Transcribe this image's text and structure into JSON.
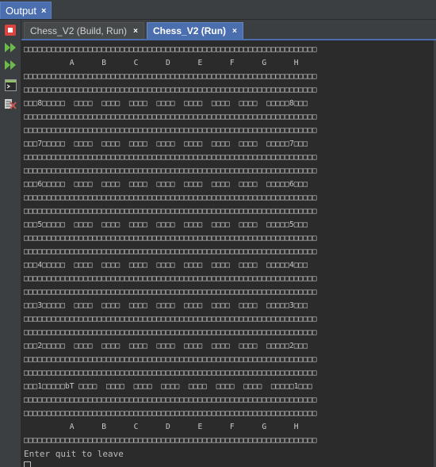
{
  "window": {
    "output_tab_label": "Output",
    "output_tab_close": "×"
  },
  "run_tabs": [
    {
      "label": "Chess_V2 (Build, Run)",
      "close": "×",
      "active": false
    },
    {
      "label": "Chess_V2 (Run)",
      "close": "×",
      "active": true
    }
  ],
  "sidebar": {
    "buttons": [
      {
        "icon": "stop-icon",
        "color": "#d9453f"
      },
      {
        "icon": "rerun-icon",
        "color": "#6dbb4a"
      },
      {
        "icon": "rerun-with-different-params-icon",
        "color": "#6dbb4a"
      },
      {
        "icon": "terminal-settings-icon",
        "color": "#8fbf6a"
      },
      {
        "icon": "clear-output-icon",
        "color": "#c75450"
      }
    ]
  },
  "console": {
    "lines": [
      "□□□□□□□□□□□□□□□□□□□□□□□□□□□□□□□□□□□□□□□□□□□□□□□□□□□□□□□□□□□□□□□□",
      "          A      B      C      D      E      F      G      H",
      "□□□□□□□□□□□□□□□□□□□□□□□□□□□□□□□□□□□□□□□□□□□□□□□□□□□□□□□□□□□□□□□□",
      "□□□□□□□□□□□□□□□□□□□□□□□□□□□□□□□□□□□□□□□□□□□□□□□□□□□□□□□□□□□□□□□□",
      "□□□8□□□□□  □□□□  □□□□  □□□□  □□□□  □□□□  □□□□  □□□□  □□□□□8□□□",
      "□□□□□□□□□□□□□□□□□□□□□□□□□□□□□□□□□□□□□□□□□□□□□□□□□□□□□□□□□□□□□□□□",
      "□□□□□□□□□□□□□□□□□□□□□□□□□□□□□□□□□□□□□□□□□□□□□□□□□□□□□□□□□□□□□□□□",
      "□□□7□□□□□  □□□□  □□□□  □□□□  □□□□  □□□□  □□□□  □□□□  □□□□□7□□□",
      "□□□□□□□□□□□□□□□□□□□□□□□□□□□□□□□□□□□□□□□□□□□□□□□□□□□□□□□□□□□□□□□□",
      "□□□□□□□□□□□□□□□□□□□□□□□□□□□□□□□□□□□□□□□□□□□□□□□□□□□□□□□□□□□□□□□□",
      "□□□6□□□□□  □□□□  □□□□  □□□□  □□□□  □□□□  □□□□  □□□□  □□□□□6□□□",
      "□□□□□□□□□□□□□□□□□□□□□□□□□□□□□□□□□□□□□□□□□□□□□□□□□□□□□□□□□□□□□□□□",
      "□□□□□□□□□□□□□□□□□□□□□□□□□□□□□□□□□□□□□□□□□□□□□□□□□□□□□□□□□□□□□□□□",
      "□□□5□□□□□  □□□□  □□□□  □□□□  □□□□  □□□□  □□□□  □□□□  □□□□□5□□□",
      "□□□□□□□□□□□□□□□□□□□□□□□□□□□□□□□□□□□□□□□□□□□□□□□□□□□□□□□□□□□□□□□□",
      "□□□□□□□□□□□□□□□□□□□□□□□□□□□□□□□□□□□□□□□□□□□□□□□□□□□□□□□□□□□□□□□□",
      "□□□4□□□□□  □□□□  □□□□  □□□□  □□□□  □□□□  □□□□  □□□□  □□□□□4□□□",
      "□□□□□□□□□□□□□□□□□□□□□□□□□□□□□□□□□□□□□□□□□□□□□□□□□□□□□□□□□□□□□□□□",
      "□□□□□□□□□□□□□□□□□□□□□□□□□□□□□□□□□□□□□□□□□□□□□□□□□□□□□□□□□□□□□□□□",
      "□□□3□□□□□  □□□□  □□□□  □□□□  □□□□  □□□□  □□□□  □□□□  □□□□□3□□□",
      "□□□□□□□□□□□□□□□□□□□□□□□□□□□□□□□□□□□□□□□□□□□□□□□□□□□□□□□□□□□□□□□□",
      "□□□□□□□□□□□□□□□□□□□□□□□□□□□□□□□□□□□□□□□□□□□□□□□□□□□□□□□□□□□□□□□□",
      "□□□2□□□□□  □□□□  □□□□  □□□□  □□□□  □□□□  □□□□  □□□□  □□□□□2□□□",
      "□□□□□□□□□□□□□□□□□□□□□□□□□□□□□□□□□□□□□□□□□□□□□□□□□□□□□□□□□□□□□□□□",
      "□□□□□□□□□□□□□□□□□□□□□□□□□□□□□□□□□□□□□□□□□□□□□□□□□□□□□□□□□□□□□□□□",
      "□□□1□□□□□bT □□□□  □□□□  □□□□  □□□□  □□□□  □□□□  □□□□  □□□□□1□□□",
      "□□□□□□□□□□□□□□□□□□□□□□□□□□□□□□□□□□□□□□□□□□□□□□□□□□□□□□□□□□□□□□□□",
      "□□□□□□□□□□□□□□□□□□□□□□□□□□□□□□□□□□□□□□□□□□□□□□□□□□□□□□□□□□□□□□□□",
      "          A      B      C      D      E      F      G      H",
      "□□□□□□□□□□□□□□□□□□□□□□□□□□□□□□□□□□□□□□□□□□□□□□□□□□□□□□□□□□□□□□□□"
    ],
    "prompt": "Enter quit to leave"
  }
}
